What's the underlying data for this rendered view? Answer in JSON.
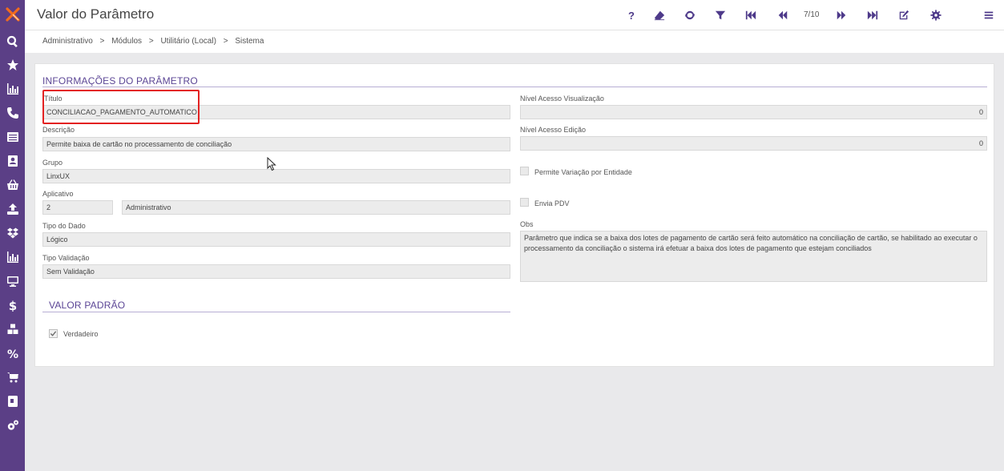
{
  "app": {
    "title": "Valor do Parâmetro",
    "record_counter": "7/10",
    "help_label": "?"
  },
  "breadcrumb": [
    "Administrativo",
    ">",
    "Módulos",
    ">",
    "Utilitário (Local)",
    ">",
    "Sistema"
  ],
  "sections": {
    "info_title": "INFORMAÇÕES DO PARÂMETRO",
    "default_title": "VALOR PADRÃO"
  },
  "form": {
    "titulo": {
      "label": "Título",
      "value": "CONCILIACAO_PAGAMENTO_AUTOMATICO"
    },
    "descricao": {
      "label": "Descrição",
      "value": "Permite baixa de cartão no processamento de conciliação"
    },
    "grupo": {
      "label": "Grupo",
      "value": "LinxUX"
    },
    "aplicativo": {
      "label": "Aplicativo",
      "code": "2",
      "name": "Administrativo"
    },
    "tipo_dado": {
      "label": "Tipo do Dado",
      "value": "Lógico"
    },
    "tipo_validacao": {
      "label": "Tipo Validação",
      "value": "Sem Validação"
    },
    "nivel_visualizacao": {
      "label": "Nível Acesso Visualização",
      "value": "0"
    },
    "nivel_edicao": {
      "label": "Nível Acesso Edição",
      "value": "0"
    },
    "permite_variacao": {
      "label": "Permite Variação por Entidade",
      "checked": false
    },
    "envia_pdv": {
      "label": "Envia PDV",
      "checked": false
    },
    "obs": {
      "label": "Obs",
      "value": "Parâmetro que indica se a baixa dos lotes de pagamento de cartão será feito automático na conciliação de cartão, se habilitado ao executar o processamento da conciliação o sistema irá efetuar a baixa dos lotes de pagamento que estejam conciliados"
    },
    "verdadeiro": {
      "label": "Verdadeiro",
      "checked": true
    }
  },
  "colors": {
    "sidebar": "#5b3f86",
    "accent": "#4e3a8a",
    "highlight": "#e32222",
    "logo_orange": "#f26b1d"
  },
  "sidebar_icons": [
    "search-icon",
    "star-icon",
    "bar-chart-icon",
    "phone-icon",
    "list-icon",
    "contact-icon",
    "basket-icon",
    "upload-icon",
    "dropbox-icon",
    "bar-chart-icon",
    "monitor-icon",
    "dollar-icon",
    "boxes-icon",
    "percent-icon",
    "cart-icon",
    "book-icon",
    "gears-icon"
  ],
  "toolbar_icons": [
    "help-icon",
    "eraser-icon",
    "refresh-icon",
    "filter-icon",
    "first-record-icon",
    "previous-record-icon",
    "next-record-icon",
    "last-record-icon",
    "edit-icon",
    "settings-icon",
    "menu-icon"
  ]
}
